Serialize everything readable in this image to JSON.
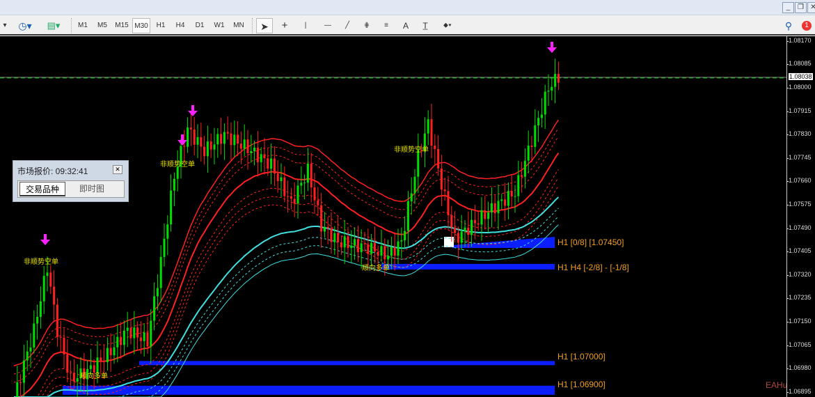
{
  "window": {
    "min": "_",
    "restore": "❐",
    "close": "✕"
  },
  "toolbar": {
    "timeframes": [
      "M1",
      "M5",
      "M15",
      "M30",
      "H1",
      "H4",
      "D1",
      "W1",
      "MN"
    ],
    "active": "M30",
    "text_tool": "A",
    "notification_count": "1"
  },
  "price_axis": {
    "ticks": [
      "1.08170",
      "1.08085",
      "1.08000",
      "1.07915",
      "1.07830",
      "1.07745",
      "1.07660",
      "1.07575",
      "1.07490",
      "1.07405",
      "1.07320",
      "1.07235",
      "1.07150",
      "1.07065",
      "1.06980",
      "1.06895"
    ],
    "current_price": "1.08038"
  },
  "levels": [
    {
      "label": "H1 [0/8] [1.07450]"
    },
    {
      "label": "H1 H4 [-2/8] - [-1/8]"
    },
    {
      "label": "H1  [1.07000]"
    },
    {
      "label": "H1  [1.06900]"
    }
  ],
  "signals": {
    "short": "非顺势空单",
    "long": "顺向多单"
  },
  "market_panel": {
    "title": "市场报价: 09:32:41",
    "tabs": [
      "交易品种",
      "即时图"
    ]
  },
  "watermark": "EAHub",
  "colors": {
    "bull": "#00e000",
    "bear": "#ff2020",
    "ma": "#ff2020",
    "ma2": "#40e0e0",
    "level": "#0a1eff",
    "arrow": "#ff20ff"
  },
  "price_path": [
    [
      0,
      1.0687
    ],
    [
      6,
      1.0712
    ],
    [
      10,
      1.0735
    ],
    [
      13,
      1.0712
    ],
    [
      17,
      1.0694
    ],
    [
      22,
      1.0697
    ],
    [
      28,
      1.0703
    ],
    [
      34,
      1.0712
    ],
    [
      40,
      1.0708
    ],
    [
      44,
      1.0737
    ],
    [
      48,
      1.0768
    ],
    [
      52,
      1.0785
    ],
    [
      57,
      1.0777
    ],
    [
      63,
      1.0783
    ],
    [
      70,
      1.0778
    ],
    [
      77,
      1.0772
    ],
    [
      83,
      1.0758
    ],
    [
      88,
      1.077
    ],
    [
      92,
      1.075
    ],
    [
      97,
      1.0744
    ],
    [
      106,
      1.0742
    ],
    [
      112,
      1.0739
    ],
    [
      116,
      1.0744
    ],
    [
      121,
      1.0775
    ],
    [
      124,
      1.0787
    ],
    [
      128,
      1.0765
    ],
    [
      132,
      1.0745
    ],
    [
      136,
      1.0749
    ],
    [
      143,
      1.0756
    ],
    [
      150,
      1.0762
    ],
    [
      155,
      1.0781
    ],
    [
      160,
      1.08
    ],
    [
      163,
      1.0804
    ]
  ]
}
